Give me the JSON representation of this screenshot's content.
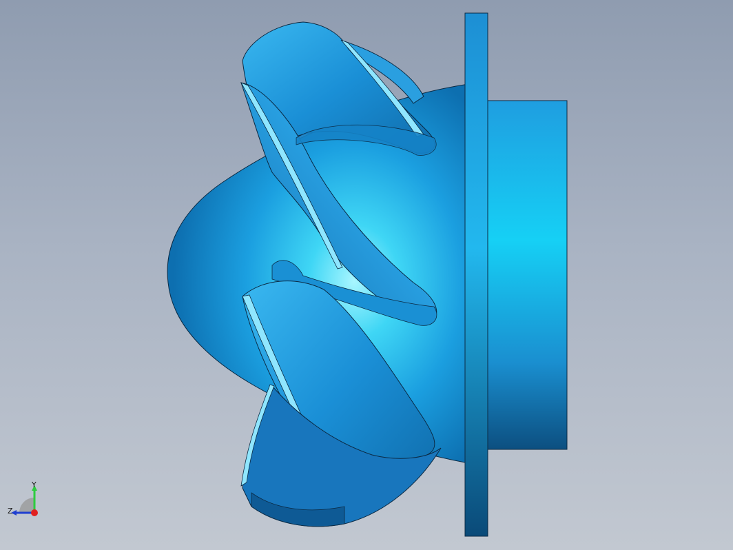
{
  "viewport": {
    "background_top": "#8f9cb0",
    "background_bottom": "#c2c8d1"
  },
  "model": {
    "description_icon": "impeller-3d-model",
    "color": "#1aa0e6",
    "highlight_color": "#9ff3ff",
    "edge_color": "#0b2a44"
  },
  "triad": {
    "y_label": "Y",
    "z_label": "Z",
    "y_color": "#2ecc40",
    "z_color": "#1f3fd0",
    "x_color": "#e02020"
  }
}
